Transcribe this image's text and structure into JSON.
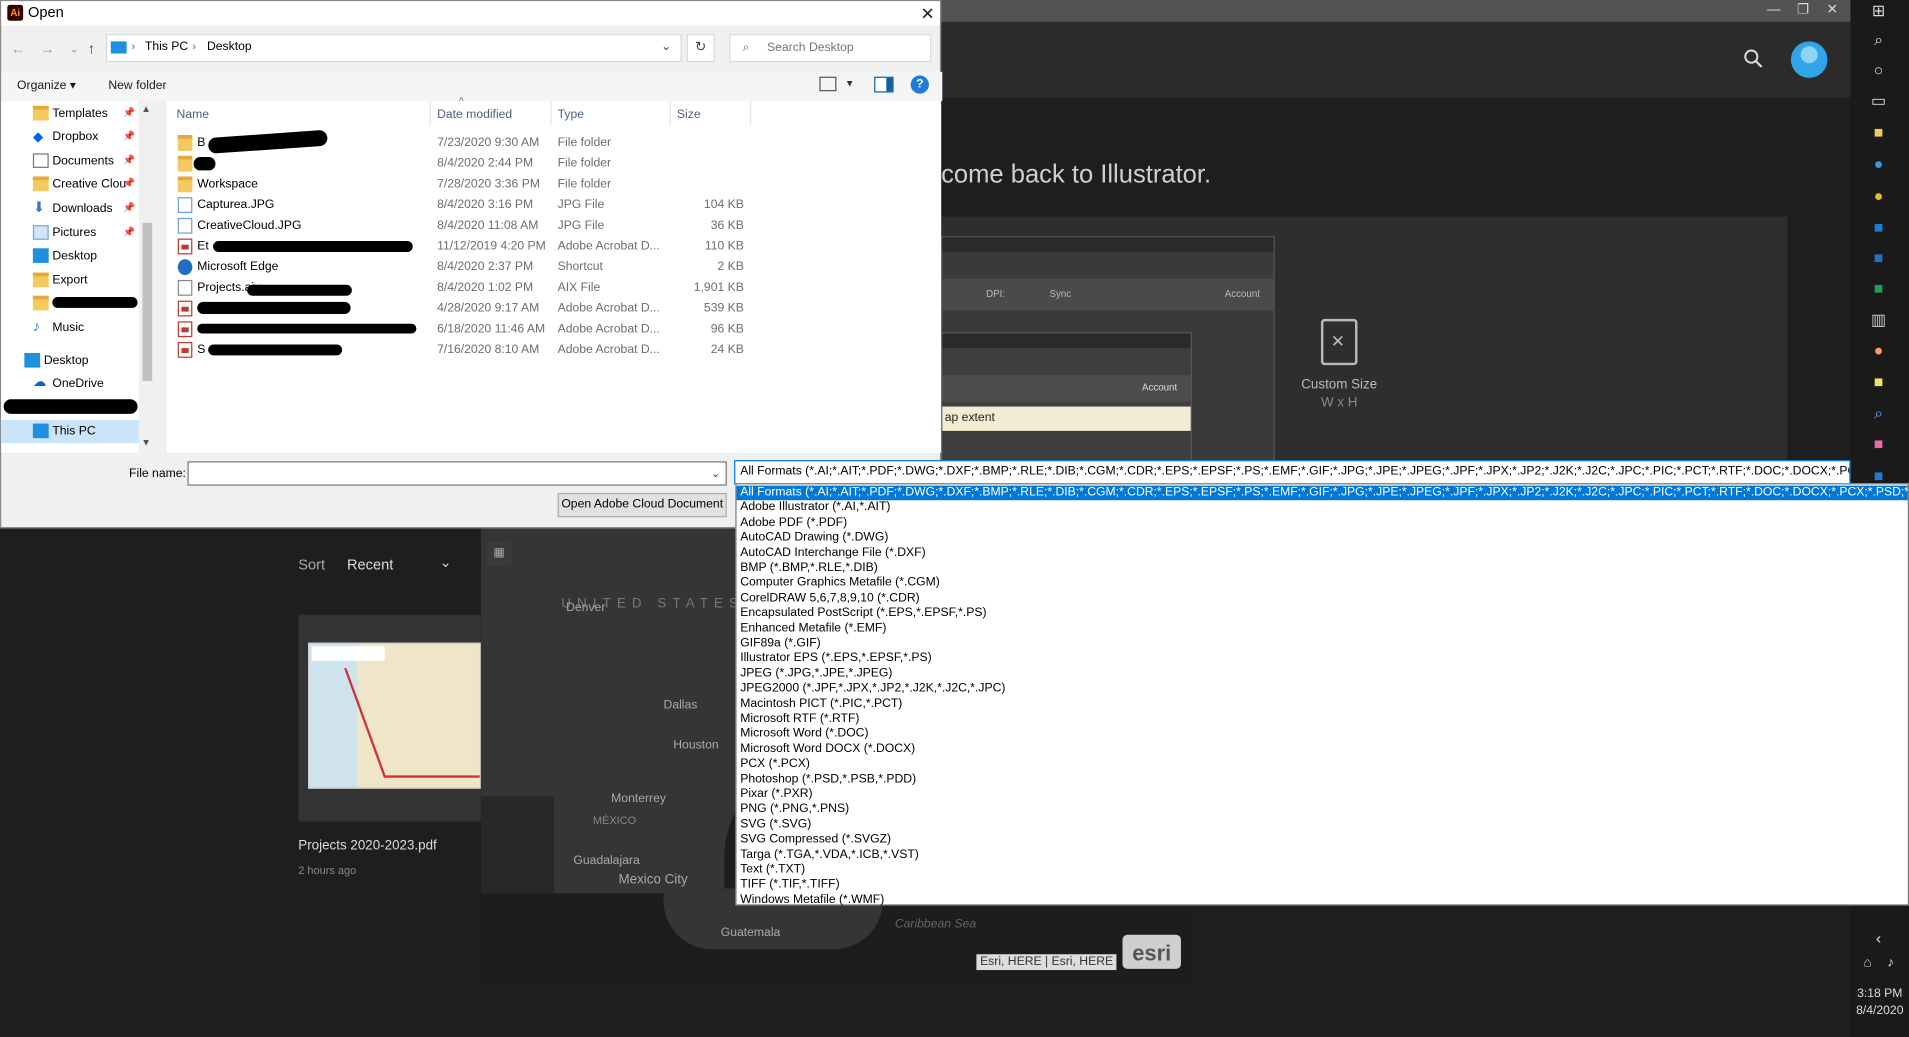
{
  "dialog": {
    "title": "Open",
    "close_glyph": "✕",
    "address": {
      "root": "This PC",
      "current": "Desktop"
    },
    "search_placeholder": "Search Desktop",
    "toolbar": {
      "organize": "Organize ▾",
      "new_folder": "New folder",
      "help": "?"
    },
    "columns": {
      "name": "Name",
      "date": "Date modified",
      "type": "Type",
      "size": "Size"
    },
    "nav_items": [
      {
        "label": "Templates",
        "icon": "folder-icon",
        "pinned": true
      },
      {
        "label": "Dropbox",
        "icon": "dropbox-icon",
        "pinned": true
      },
      {
        "label": "Documents",
        "icon": "documents-icon",
        "pinned": true
      },
      {
        "label": "Creative Clou",
        "icon": "creative-cloud-icon",
        "pinned": true
      },
      {
        "label": "Downloads",
        "icon": "downloads-icon",
        "pinned": true
      },
      {
        "label": "Pictures",
        "icon": "pictures-icon",
        "pinned": true
      },
      {
        "label": "Desktop",
        "icon": "desktop-icon",
        "pinned": false
      },
      {
        "label": "Export",
        "icon": "folder-icon",
        "pinned": false
      },
      {
        "label": "",
        "icon": "folder-icon",
        "pinned": false
      },
      {
        "label": "Music",
        "icon": "music-icon",
        "pinned": false
      },
      {
        "label": "Desktop",
        "icon": "desktop-icon",
        "pinned": false
      },
      {
        "label": "OneDrive",
        "icon": "onedrive-icon",
        "pinned": false
      },
      {
        "label": "",
        "icon": "user-icon",
        "pinned": false
      },
      {
        "label": "This PC",
        "icon": "pc-icon",
        "pinned": false
      }
    ],
    "files": [
      {
        "name": "B",
        "date": "7/23/2020 9:30 AM",
        "type": "File folder",
        "size": "",
        "icon": "folder"
      },
      {
        "name": "",
        "date": "8/4/2020 2:44 PM",
        "type": "File folder",
        "size": "",
        "icon": "folder"
      },
      {
        "name": "Workspace",
        "date": "7/28/2020 3:36 PM",
        "type": "File folder",
        "size": "",
        "icon": "folder"
      },
      {
        "name": "Capturea.JPG",
        "date": "8/4/2020 3:16 PM",
        "type": "JPG File",
        "size": "104 KB",
        "icon": "jpg"
      },
      {
        "name": "CreativeCloud.JPG",
        "date": "8/4/2020 11:08 AM",
        "type": "JPG File",
        "size": "36 KB",
        "icon": "jpg"
      },
      {
        "name": "Et",
        "date": "11/12/2019 4:20 PM",
        "type": "Adobe Acrobat D...",
        "size": "110 KB",
        "icon": "pdf"
      },
      {
        "name": "Microsoft Edge",
        "date": "8/4/2020 2:37 PM",
        "type": "Shortcut",
        "size": "2 KB",
        "icon": "edge"
      },
      {
        "name": "Projects.aix",
        "date": "8/4/2020 1:02 PM",
        "type": "AIX File",
        "size": "1,901 KB",
        "icon": "aix"
      },
      {
        "name": "",
        "date": "4/28/2020 9:17 AM",
        "type": "Adobe Acrobat D...",
        "size": "539 KB",
        "icon": "pdf"
      },
      {
        "name": "",
        "date": "6/18/2020 11:46 AM",
        "type": "Adobe Acrobat D...",
        "size": "96 KB",
        "icon": "pdf"
      },
      {
        "name": "S",
        "date": "7/16/2020 8:10 AM",
        "type": "Adobe Acrobat D...",
        "size": "24 KB",
        "icon": "pdf"
      }
    ],
    "file_name_label": "File name:",
    "file_name_value": "",
    "file_type_selected": "All Formats (*.AI;*.AIT;*.PDF;*.DWG;*.DXF;*.BMP;*.RLE;*.DIB;*.CGM;*.CDR;*.EPS;*.EPSF;*.PS;*.EMF;*.GIF;*.JPG;*.JPE;*.JPEG;*.JPF;*.JPX;*.JP2;*.J2K;*.J2C;*.JPC;*.PIC;*.PCT;*.RTF;*.DOC;*.DOCX;*.PCX;*.PSD;*.PSB;*.PDD;*.",
    "cloud_button": "Open Adobe Cloud Document",
    "type_options": [
      "All Formats (*.AI;*.AIT;*.PDF;*.DWG;*.DXF;*.BMP;*.RLE;*.DIB;*.CGM;*.CDR;*.EPS;*.EPSF;*.PS;*.EMF;*.GIF;*.JPG;*.JPE;*.JPEG;*.JPF;*.JPX;*.JP2;*.J2K;*.J2C;*.JPC;*.PIC;*.PCT;*.RTF;*.DOC;*.DOCX;*.PCX;*.PSD;*.PSB;*.PDD;*.PXR;*.PNG",
      "Adobe Illustrator (*.AI,*.AIT)",
      "Adobe PDF (*.PDF)",
      "AutoCAD Drawing (*.DWG)",
      "AutoCAD Interchange File (*.DXF)",
      "BMP (*.BMP,*.RLE,*.DIB)",
      "Computer Graphics Metafile (*.CGM)",
      "CorelDRAW 5,6,7,8,9,10 (*.CDR)",
      "Encapsulated PostScript (*.EPS,*.EPSF,*.PS)",
      "Enhanced Metafile (*.EMF)",
      "GIF89a (*.GIF)",
      "Illustrator EPS (*.EPS,*.EPSF,*.PS)",
      "JPEG (*.JPG,*.JPE,*.JPEG)",
      "JPEG2000 (*.JPF,*.JPX,*.JP2,*.J2K,*.J2C,*.JPC)",
      "Macintosh PICT (*.PIC,*.PCT)",
      "Microsoft RTF (*.RTF)",
      "Microsoft Word (*.DOC)",
      "Microsoft Word DOCX (*.DOCX)",
      "PCX (*.PCX)",
      "Photoshop (*.PSD,*.PSB,*.PDD)",
      "Pixar (*.PXR)",
      "PNG (*.PNG,*.PNS)",
      "SVG (*.SVG)",
      "SVG Compressed (*.SVGZ)",
      "Targa (*.TGA,*.VDA,*.ICB,*.VST)",
      "Text (*.TXT)",
      "TIFF (*.TIF,*.TIFF)",
      "Windows Metafile (*.WMF)"
    ]
  },
  "illustrator": {
    "welcome": "come back to Illustrator.",
    "mini_screen": {
      "dpi": "DPI:",
      "sync": "Sync",
      "account": "Account",
      "map_extent": "ap extent"
    },
    "custom_size": {
      "label": "Custom Size",
      "dims": "W x H"
    },
    "sort_label": "Sort",
    "sort_value": "Recent",
    "recent_file": {
      "name": "Projects 2020-2023.pdf",
      "time": "2 hours ago"
    },
    "map": {
      "labels": [
        {
          "text": "UNITED STATES",
          "kind": "country"
        },
        {
          "text": "Denver",
          "kind": "city"
        },
        {
          "text": "Dallas",
          "kind": "city"
        },
        {
          "text": "Houston",
          "kind": "city"
        },
        {
          "text": "Monterrey",
          "kind": "city"
        },
        {
          "text": "MÉXICO",
          "kind": "country"
        },
        {
          "text": "Guadalajara",
          "kind": "city"
        },
        {
          "text": "Mexico City",
          "kind": "city"
        },
        {
          "text": "Guatemala",
          "kind": "city"
        },
        {
          "text": "Caribbean Sea",
          "kind": "water"
        }
      ],
      "attribution": "Esri, HERE | Esri, HERE",
      "logo": "esri"
    }
  },
  "taskbar": {
    "time": "3:18 PM",
    "date": "8/4/2020",
    "icons": [
      "windows-icon",
      "search-icon",
      "cortana-icon",
      "task-view-icon",
      "file-explorer-icon",
      "edge-icon",
      "chrome-icon",
      "outlook-icon",
      "word-icon",
      "excel-icon",
      "calculator-icon",
      "paint-icon",
      "sticky-notes-icon",
      "magnifier-icon",
      "photos-icon",
      "outlook-icon"
    ]
  },
  "colors": {
    "selection": "#0078d7",
    "dark_bg": "#1e1e1e",
    "dialog_bg": "#f0f0f0"
  }
}
